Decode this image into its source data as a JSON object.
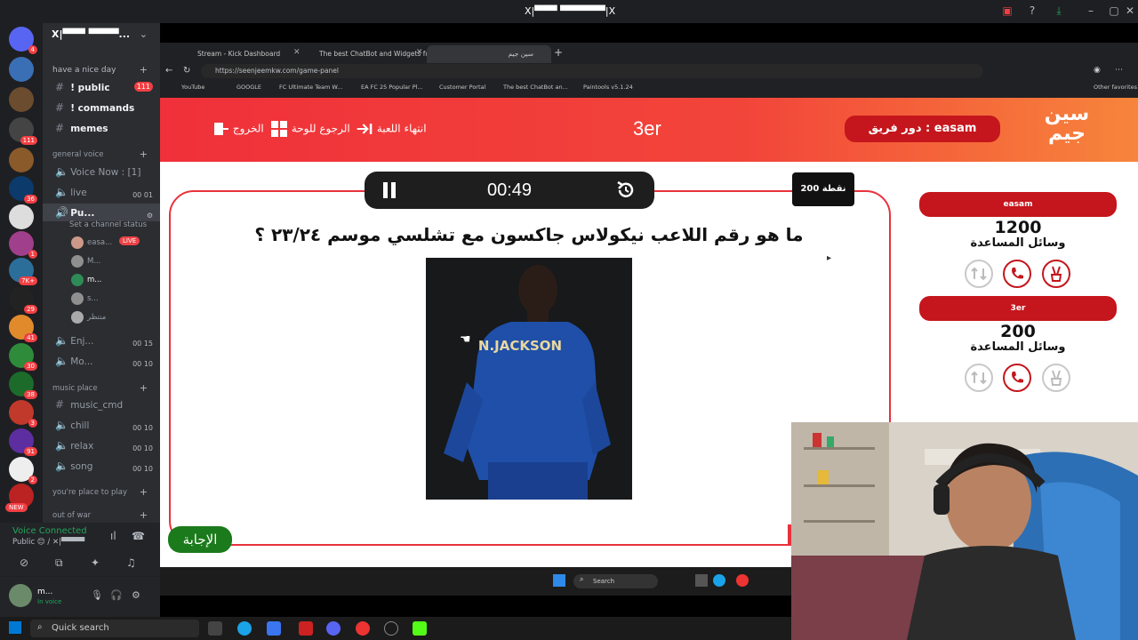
{
  "window": {
    "title": "X|▀▀▀ ▀▀▀▀▀▀|X"
  },
  "discord": {
    "greeting": "have a nice day",
    "channels": [
      {
        "name": "! public",
        "count": "111"
      },
      {
        "name": "! commands"
      },
      {
        "name": "memes"
      }
    ],
    "general_voice": "general voice",
    "voice_now": "Voice Now : [1]",
    "voice_channels": [
      {
        "name": "live",
        "count": "00 01"
      },
      {
        "name": "Pu...",
        "sub": "Set a channel status"
      }
    ],
    "members": [
      "easa...",
      "M...",
      "m...",
      "s...",
      "منتظر"
    ],
    "live_badge": "LIVE",
    "more_voice": [
      {
        "name": "Enj...",
        "count": "00 15"
      },
      {
        "name": "Mo...",
        "count": "00 10"
      }
    ],
    "music_place": "music place",
    "music_channels": [
      {
        "name": "music_cmd"
      },
      {
        "name": "chill",
        "count": "00 10"
      },
      {
        "name": "relax",
        "count": "00 10"
      },
      {
        "name": "song",
        "count": "00 10"
      }
    ],
    "you_place": "you're place to play",
    "out_of_war": "out of war",
    "new_badge": "NEW",
    "voice_connected": "Voice Connected",
    "voice_sub": "Public 😊 / ✕|▀▀▀▀",
    "user_name": "m...",
    "user_status": "In voice"
  },
  "browser": {
    "tabs": [
      {
        "label": "Stream - Kick Dashboard"
      },
      {
        "label": "The best ChatBot and Widgets fo..."
      },
      {
        "label": "سين جيم"
      }
    ],
    "url": "https://seenjeemkw.com/game-panel",
    "bookmarks": [
      "YouTube",
      "GOOGLE",
      "FC Ultimate Team W...",
      "EA FC 25 Popular Pl...",
      "Customer Portal",
      "The best ChatBot an...",
      "Paintools v5.1.24"
    ],
    "other_favorites": "Other favorites"
  },
  "game": {
    "header_buttons": [
      {
        "label": "الخروج"
      },
      {
        "label": "الرجوع للوحة"
      },
      {
        "label": "انتهاء اللعبة"
      }
    ],
    "title": "3er",
    "turn_label": "دور فريق : easam",
    "logo": "سين جيم",
    "timer": "00:49",
    "points": "200 نقطة",
    "question": "ما هو رقم اللاعب نيكولاس جاكسون مع تشلسي موسم ٢٣/٢٤ ؟",
    "jersey_text": "N.JACKSON",
    "answer_button": "الإجابة",
    "teams": [
      {
        "name": "easam",
        "score": "1200",
        "help_label": "وسائل المساعدة"
      },
      {
        "name": "3er",
        "score": "200",
        "help_label": "وسائل المساعدة"
      }
    ]
  },
  "taskbar": {
    "inner_search": "Search",
    "quick_search": "Quick search"
  },
  "colors": {
    "accent_red": "#c4161c",
    "header_gradient_start": "#f0303a",
    "header_gradient_end": "#f7853b",
    "answer_green": "#1b7a1b",
    "discord_bg": "#2b2d31"
  }
}
